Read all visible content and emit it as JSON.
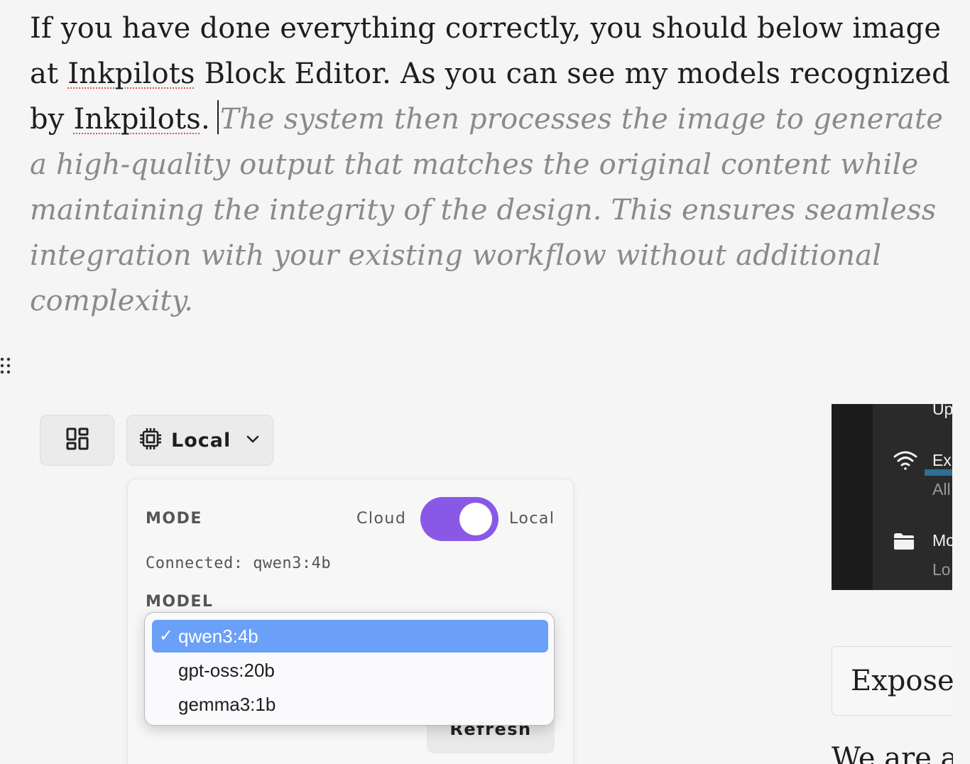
{
  "paragraph": {
    "line_pre_a": "If you have done everything correctly, you should below image at ",
    "link_a": "Inkpilots",
    "line_mid": " Block Editor. As you can see my models recognized by ",
    "link_b": "Inkpilots",
    "line_end": ".",
    "suggestion": "The system then processes the image to generate a high-quality output that matches the original content while maintaining the integrity of the design. This ensures seamless integration with your existing workflow without additional complexity."
  },
  "toolbar": {
    "mode_button_label": "Local"
  },
  "panel": {
    "mode_label": "MODE",
    "toggle_left": "Cloud",
    "toggle_right": "Local",
    "toggle_on": true,
    "connected_status": "Connected: qwen3:4b",
    "model_label": "MODEL",
    "refresh_label": "Refresh"
  },
  "model_select": {
    "selected": "qwen3:4b",
    "options": [
      "qwen3:4b",
      "gpt-oss:20b",
      "gemma3:1b"
    ],
    "check_glyph": "✓"
  },
  "side_preview": {
    "item1_title": "Up",
    "item2_title": "Ex",
    "item2_sub": "All",
    "item3_title": "Mo",
    "item3_sub": "Lo"
  },
  "side_card": {
    "title": "Expose",
    "next_text": "We are a"
  },
  "colors": {
    "accent": "#8a58e6",
    "select_highlight": "#6aa0f7",
    "suggestion_text": "#8a8a8a",
    "spellcheck": "#e0534b"
  }
}
